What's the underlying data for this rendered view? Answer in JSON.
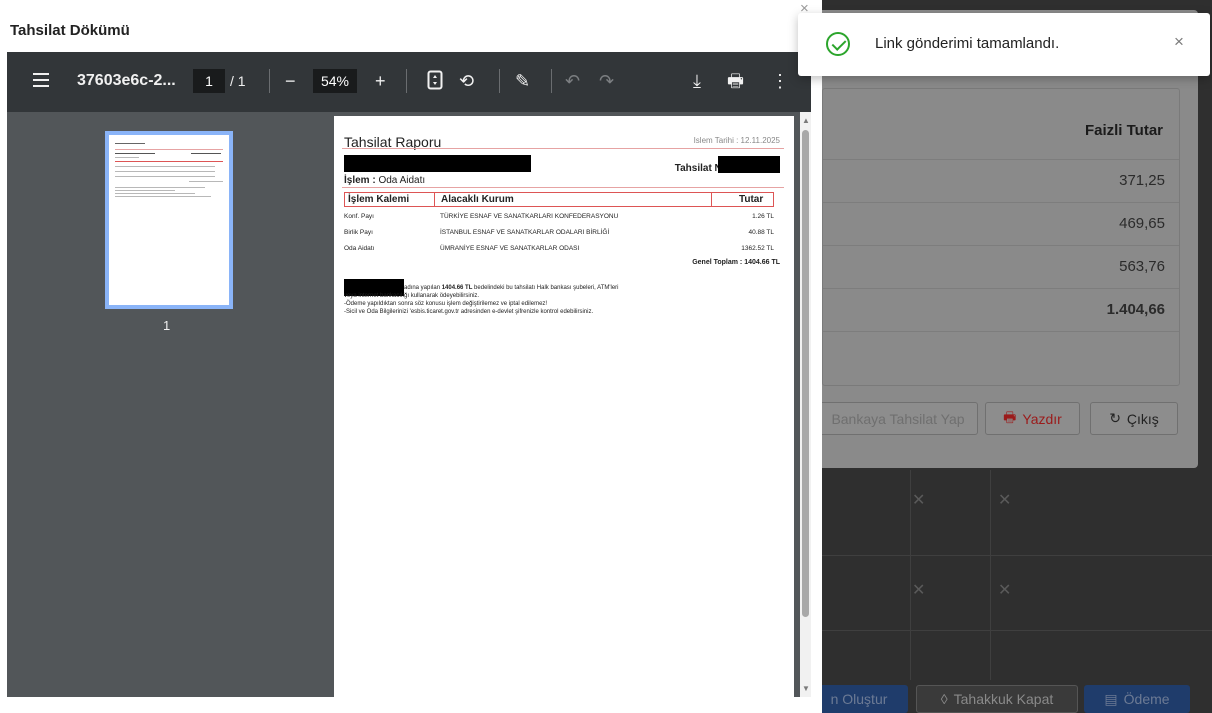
{
  "modal": {
    "title": "Tahsilat Dökümü",
    "close": "×"
  },
  "viewer": {
    "filename": "37603e6c-2...",
    "page_current": "1",
    "page_total": "/ 1",
    "zoom": "54%",
    "thumb_label": "1"
  },
  "pdf": {
    "title": "Tahsilat Raporu",
    "date_label": "Islem Tarihi : 12.11.2025",
    "tahsilat_no_label": "Tahsilat No :",
    "islem_label": "İşlem :",
    "islem_value": "Oda Aidatı",
    "columns": [
      "İşlem Kalemi",
      "Alacaklı Kurum",
      "Tutar"
    ],
    "rows": [
      {
        "kalem": "Konf. Payı",
        "kurum": "TÜRKİYE ESNAF VE SANATKARLARI KONFEDERASYONU",
        "tutar": "1.26 TL"
      },
      {
        "kalem": "Birlik Payı",
        "kurum": "İSTANBUL ESNAF VE SANATKARLAR ODALARI BİRLİĞİ",
        "tutar": "40.88 TL"
      },
      {
        "kalem": "Oda Aidatı",
        "kurum": "ÜMRANİYE ESNAF VE SANATKARLAR ODASI",
        "tutar": "1362.52 TL"
      }
    ],
    "total": "Genel Toplam : 1404.66 TL",
    "note_1a": "adına yapılan ",
    "note_1b": "1404.66 TL",
    "note_1c": " bedelindeki bu tahsilatı Halk bankası şubeleri, ATM'leri",
    "note_2": "veya internet bankacılığı kullanarak ödeyebilirsiniz.",
    "note_3": "-Ödeme yapıldıktan sonra söz konusu işlem değiştirilemez ve iptal edilemez!",
    "note_4": "-Sicil ve Oda Bilgilerinizi 'esbis.ticaret.gov.tr adresinden e-devlet şifrenizle kontrol edebilirsiniz."
  },
  "toast": {
    "message": "Link gönderimi tamamlandı.",
    "close": "×"
  },
  "background": {
    "column_header": "Faizli Tutar",
    "values": [
      "371,25",
      "469,65",
      "563,76",
      "1.404,66"
    ],
    "buttons": {
      "bank": "Bankaya Tahsilat Yap",
      "print": "Yazdır",
      "exit": "Çıkış"
    },
    "bottom_buttons": {
      "create": "n Oluştur",
      "close_accrual": "Tahakkuk Kapat",
      "payment": "Ödeme"
    }
  }
}
